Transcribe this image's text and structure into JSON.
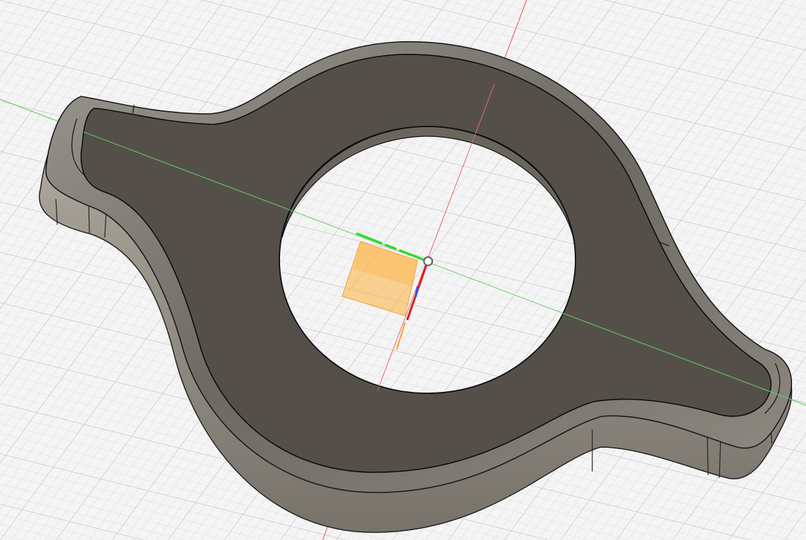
{
  "viewport": {
    "name": "3d-viewport",
    "view_mode": "shaded-with-visible-edges",
    "grid_visible": true
  },
  "colors": {
    "background": "#f4f4f4",
    "grid_minor": "#d8d8d8",
    "grid_major": "#bdbdbd",
    "axis_red": "#e05050",
    "axis_green": "#45c845",
    "body_top": "#545049",
    "body_side": "#8b887f",
    "edge": "#111111",
    "origin_plane": "#ffb340"
  },
  "model": {
    "shape": "flanged-ring",
    "has_center_hole": true,
    "edge_fillet": true
  },
  "origin_widget": {
    "triad": [
      "x-axis",
      "y-axis",
      "z-axis"
    ],
    "origin_point": true,
    "highlighted_plane": true
  }
}
